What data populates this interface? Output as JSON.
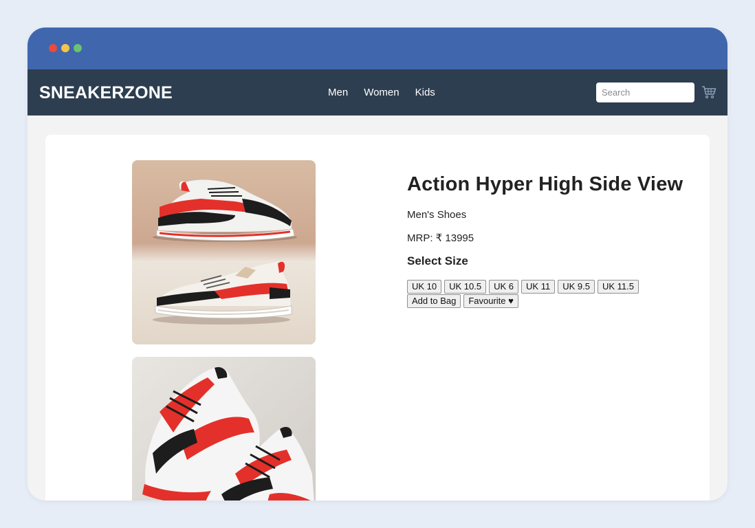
{
  "brand": {
    "name": "SNEAKERZONE"
  },
  "nav": {
    "links": [
      "Men",
      "Women",
      "Kids"
    ]
  },
  "search": {
    "placeholder": "Search"
  },
  "icons": {
    "cart": "cart-icon"
  },
  "product": {
    "title": "Action Hyper High Side View",
    "category": "Men's Shoes",
    "price": "MRP: ₹ 13995",
    "size_heading": "Select Size",
    "sizes": [
      "UK 10",
      "UK 10.5",
      "UK 6",
      "UK 11",
      "UK 9.5",
      "UK 11.5"
    ],
    "add_to_bag": "Add to Bag",
    "favourite": "Favourite ♥"
  },
  "colors": {
    "titlebar": "#4066ad",
    "navbar": "#2d3e50",
    "shoe_accent": "#e4302a"
  }
}
